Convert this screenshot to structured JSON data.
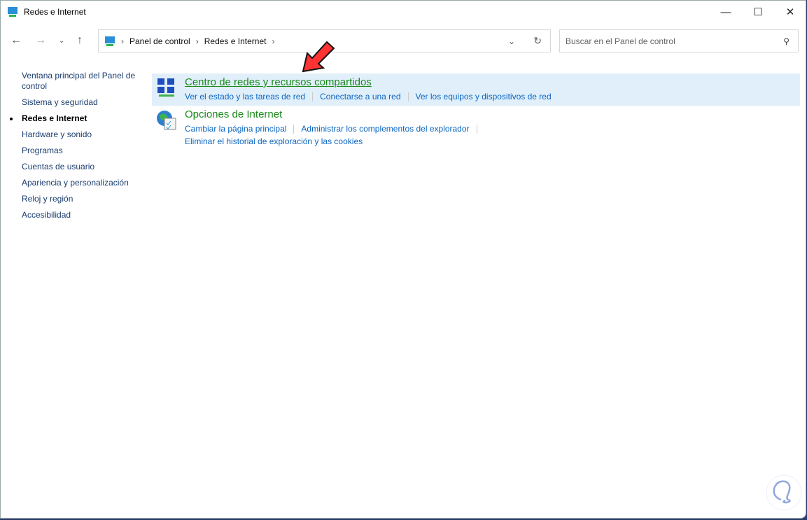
{
  "window": {
    "title": "Redes e Internet"
  },
  "breadcrumb": [
    "Panel de control",
    "Redes e Internet"
  ],
  "search": {
    "placeholder": "Buscar en el Panel de control"
  },
  "sidebar": {
    "items": [
      {
        "label": "Ventana principal del Panel de control"
      },
      {
        "label": "Sistema y seguridad"
      },
      {
        "label": "Redes e Internet",
        "current": true
      },
      {
        "label": "Hardware y sonido"
      },
      {
        "label": "Programas"
      },
      {
        "label": "Cuentas de usuario"
      },
      {
        "label": "Apariencia y personalización"
      },
      {
        "label": "Reloj y región"
      },
      {
        "label": "Accesibilidad"
      }
    ]
  },
  "categories": [
    {
      "title": "Centro de redes y recursos compartidos",
      "icon": "network-center-icon",
      "links": [
        "Ver el estado y las tareas de red",
        "Conectarse a una red",
        "Ver los equipos y dispositivos de red"
      ]
    },
    {
      "title": "Opciones de Internet",
      "icon": "internet-options-icon",
      "links": [
        "Cambiar la página principal",
        "Administrar los complementos del explorador",
        "Eliminar el historial de exploración y las cookies"
      ]
    }
  ],
  "colors": {
    "heading": "#1b8a1b",
    "link": "#0a66c2",
    "highlight": "#e0effa",
    "arrow": "#ff3333"
  }
}
